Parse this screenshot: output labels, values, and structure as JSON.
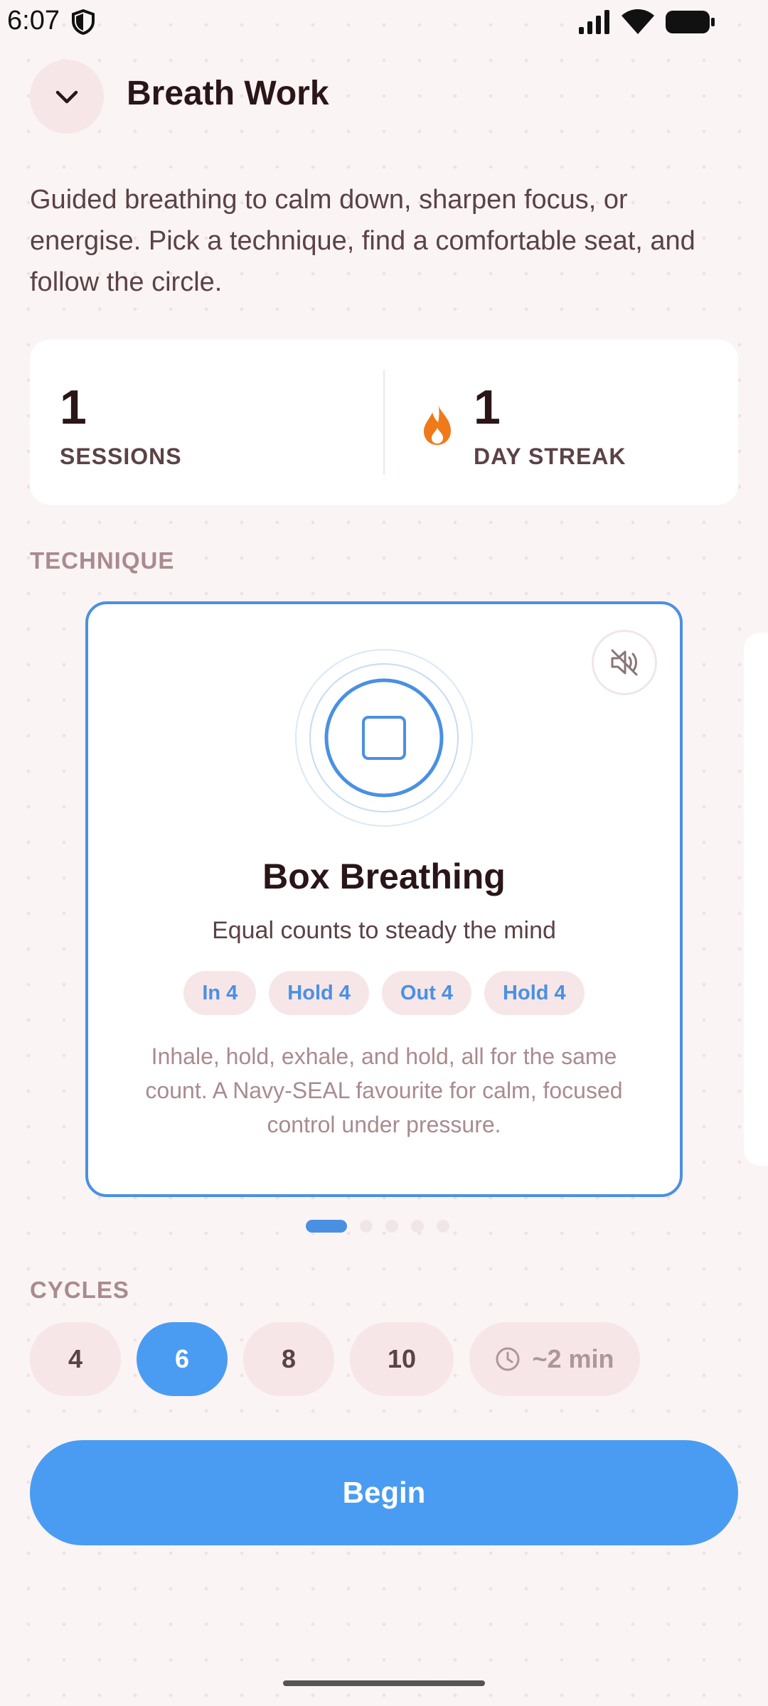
{
  "status_bar": {
    "time": "6:07",
    "icons": [
      "shield-icon",
      "signal-icon",
      "wifi-icon",
      "battery-icon"
    ]
  },
  "header": {
    "back_icon": "chevron-down-icon",
    "title": "Breath Work"
  },
  "intro": "Guided breathing to calm down, sharpen focus, or energise. Pick a technique, find a comfortable seat, and follow the circle.",
  "stats": {
    "sessions_value": "1",
    "sessions_label": "SESSIONS",
    "streak_value": "1",
    "streak_label": "DAY STREAK",
    "streak_icon": "flame-icon"
  },
  "technique_section_label": "TECHNIQUE",
  "technique_card": {
    "title": "Box Breathing",
    "subtitle": "Equal counts to steady the mind",
    "phases": [
      {
        "label": "In 4"
      },
      {
        "label": "Hold 4"
      },
      {
        "label": "Out 4"
      },
      {
        "label": "Hold 4"
      }
    ],
    "description": "Inhale, hold, exhale, and hold, all for the same count. A Navy-SEAL favourite for calm, focused control under pressure.",
    "mute_icon": "muted-speaker-icon",
    "visual_icon": "square-icon"
  },
  "pager": {
    "count": 5,
    "active_index": 0
  },
  "cycles_section_label": "CYCLES",
  "cycles": {
    "options": [
      "4",
      "6",
      "8",
      "10"
    ],
    "selected": "6",
    "duration": "~2 min",
    "duration_icon": "clock-icon"
  },
  "begin_label": "Begin",
  "colors": {
    "accent": "#4a90e2",
    "button": "#4a9cf2",
    "background": "#fbf4f4",
    "chip": "#f6e6e8",
    "flame": "#f07a1a"
  }
}
